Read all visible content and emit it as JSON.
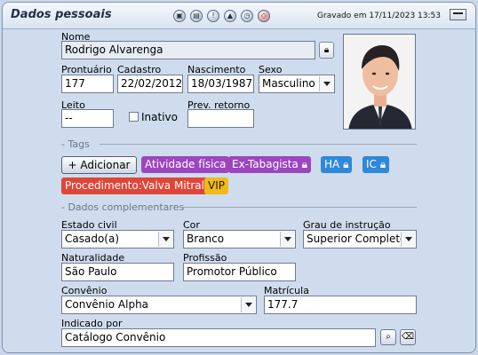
{
  "window": {
    "title": "Dados pessoais",
    "saved_text": "Gravado em 17/11/2023 13:53",
    "toolbar_icons": [
      "save-icon",
      "document-icon",
      "alert-icon",
      "upload-icon",
      "clock-icon",
      "compass-icon"
    ]
  },
  "identity": {
    "name_label": "Nome",
    "name_value": "Rodrigo Alvarenga",
    "prontuario_label": "Prontuário",
    "prontuario_value": "177",
    "cadastro_label": "Cadastro",
    "cadastro_value": "22/02/2012",
    "nascimento_label": "Nascimento",
    "nascimento_value": "18/03/1987",
    "sexo_label": "Sexo",
    "sexo_value": "Masculino",
    "leito_label": "Leito",
    "leito_value": "--",
    "inativo_label": "Inativo",
    "inativo_checked": false,
    "prev_retorno_label": "Prev. retorno",
    "prev_retorno_value": ""
  },
  "tags": {
    "section_title": "- Tags",
    "add_label": "+ Adicionar",
    "items": [
      {
        "label": "Atividade física",
        "color": "#9b46bf",
        "locked": false
      },
      {
        "label": "Ex-Tabagista",
        "color": "#9b46bf",
        "locked": true
      },
      {
        "label": "HA",
        "color": "#2f88d8",
        "locked": true
      },
      {
        "label": "IC",
        "color": "#2f88d8",
        "locked": true
      },
      {
        "label": "Procedimento:Valva Mitral",
        "color": "#df4639",
        "locked": false
      },
      {
        "label": "VIP",
        "color": "#f0bb16",
        "locked": false
      }
    ]
  },
  "complementares": {
    "section_title": "- Dados complementares",
    "estado_civil_label": "Estado civil",
    "estado_civil_value": "Casado(a)",
    "cor_label": "Cor",
    "cor_value": "Branco",
    "grau_label": "Grau de instrução",
    "grau_value": "Superior Completo",
    "naturalidade_label": "Naturalidade",
    "naturalidade_value": "São Paulo",
    "profissao_label": "Profissão",
    "profissao_value": "Promotor Público",
    "convenio_label": "Convênio",
    "convenio_value": "Convênio Alpha",
    "matricula_label": "Matrícula",
    "matricula_value": "177.7",
    "indicado_label": "Indicado por",
    "indicado_value": "Catálogo Convênio"
  }
}
